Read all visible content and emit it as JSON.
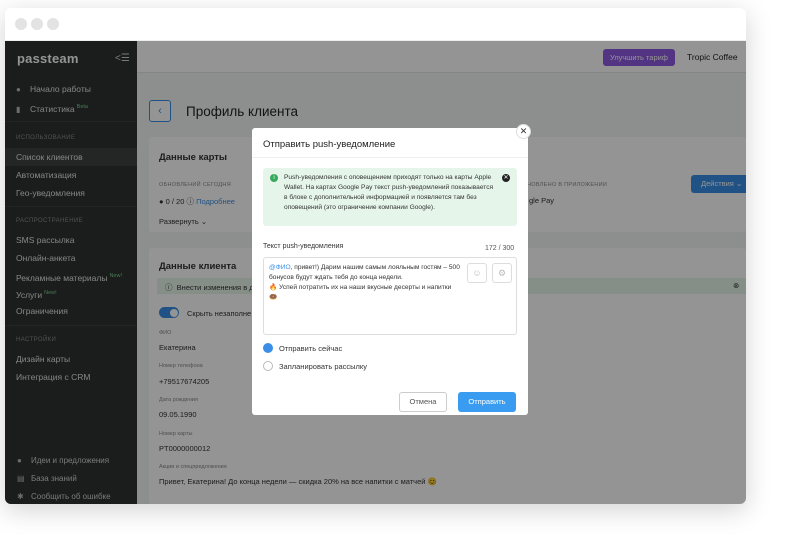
{
  "sidebar": {
    "logo": "passteam",
    "top_items": [
      {
        "label": "Начало работы"
      },
      {
        "label": "Статистика",
        "badge": "Beta"
      }
    ],
    "section_usage": "ИСПОЛЬЗОВАНИЕ",
    "usage_items": [
      {
        "label": "Список клиентов"
      },
      {
        "label": "Автоматизация"
      },
      {
        "label": "Гео-уведомления"
      }
    ],
    "section_distribution": "РАСПРОСТРАНЕНИЕ",
    "distribution_items": [
      {
        "label": "SMS рассылка"
      },
      {
        "label": "Онлайн-анкета"
      },
      {
        "label": "Рекламные материалы",
        "badge": "New!"
      },
      {
        "label": "Услуги",
        "badge": "New!"
      },
      {
        "label": "Ограничения"
      }
    ],
    "section_settings": "НАСТРОЙКИ",
    "settings_items": [
      {
        "label": "Дизайн карты"
      },
      {
        "label": "Интеграция с CRM"
      }
    ],
    "footer_items": [
      {
        "label": "Идеи и предложения"
      },
      {
        "label": "База знаний"
      },
      {
        "label": "Сообщить об ошибке"
      }
    ]
  },
  "topbar": {
    "upgrade_label": "Улучшить тариф",
    "company": "Tropic Coffee"
  },
  "page": {
    "title": "Профиль клиента",
    "card_data": {
      "title": "Данные карты",
      "updated_today_label": "ОБНОВЛЕНИЙ СЕГОДНЯ",
      "updated_today_value": "0 / 20",
      "details_link": "Подробнее",
      "installed_label": "НОВЛЕНО В ПРИЛОЖЕНИИ",
      "installed_value": "gle Pay",
      "actions_label": "Действия",
      "expand_label": "Развернуть"
    },
    "client_data": {
      "title": "Данные клиента",
      "notice": "Внести изменения в д",
      "hide_toggle_label": "Скрыть незаполне",
      "fields": [
        {
          "label": "ФИО",
          "value": "Екатерина"
        },
        {
          "label": "Номер телефона",
          "value": "+79517674205"
        },
        {
          "label": "Дата рождения",
          "value": "09.05.1990"
        },
        {
          "label": "Номер карты",
          "value": "PT0000000012"
        },
        {
          "label": "Акции и спецпредложения",
          "value": "Привет, Екатерина! До конца недели — скидка 20% на все напитки с матчей 😊"
        }
      ]
    }
  },
  "modal": {
    "title": "Отправить push-уведомление",
    "info": "Push-уведомления с оповещением приходят только на карты Apple Wallet. На картах Google Pay текст push-уведомлений показывается в блоке с дополнительной информацией и появляется там без оповещений (это ограничение компании Google).",
    "field_label": "Текст push-уведомления",
    "counter": "172 / 300",
    "message_mention": "@ФИО",
    "message_line1": ", привет!) Дарим нашим самым лояльным гостям – 500 бонусов будут ждать тебя до конца недели.",
    "message_line2": "🔥 Успей потратить их на наши вкусные десерты и напитки",
    "message_line3": "🍩",
    "option_now": "Отправить сейчас",
    "option_schedule": "Запланировать рассылку",
    "cancel_label": "Отмена",
    "send_label": "Отправить"
  }
}
